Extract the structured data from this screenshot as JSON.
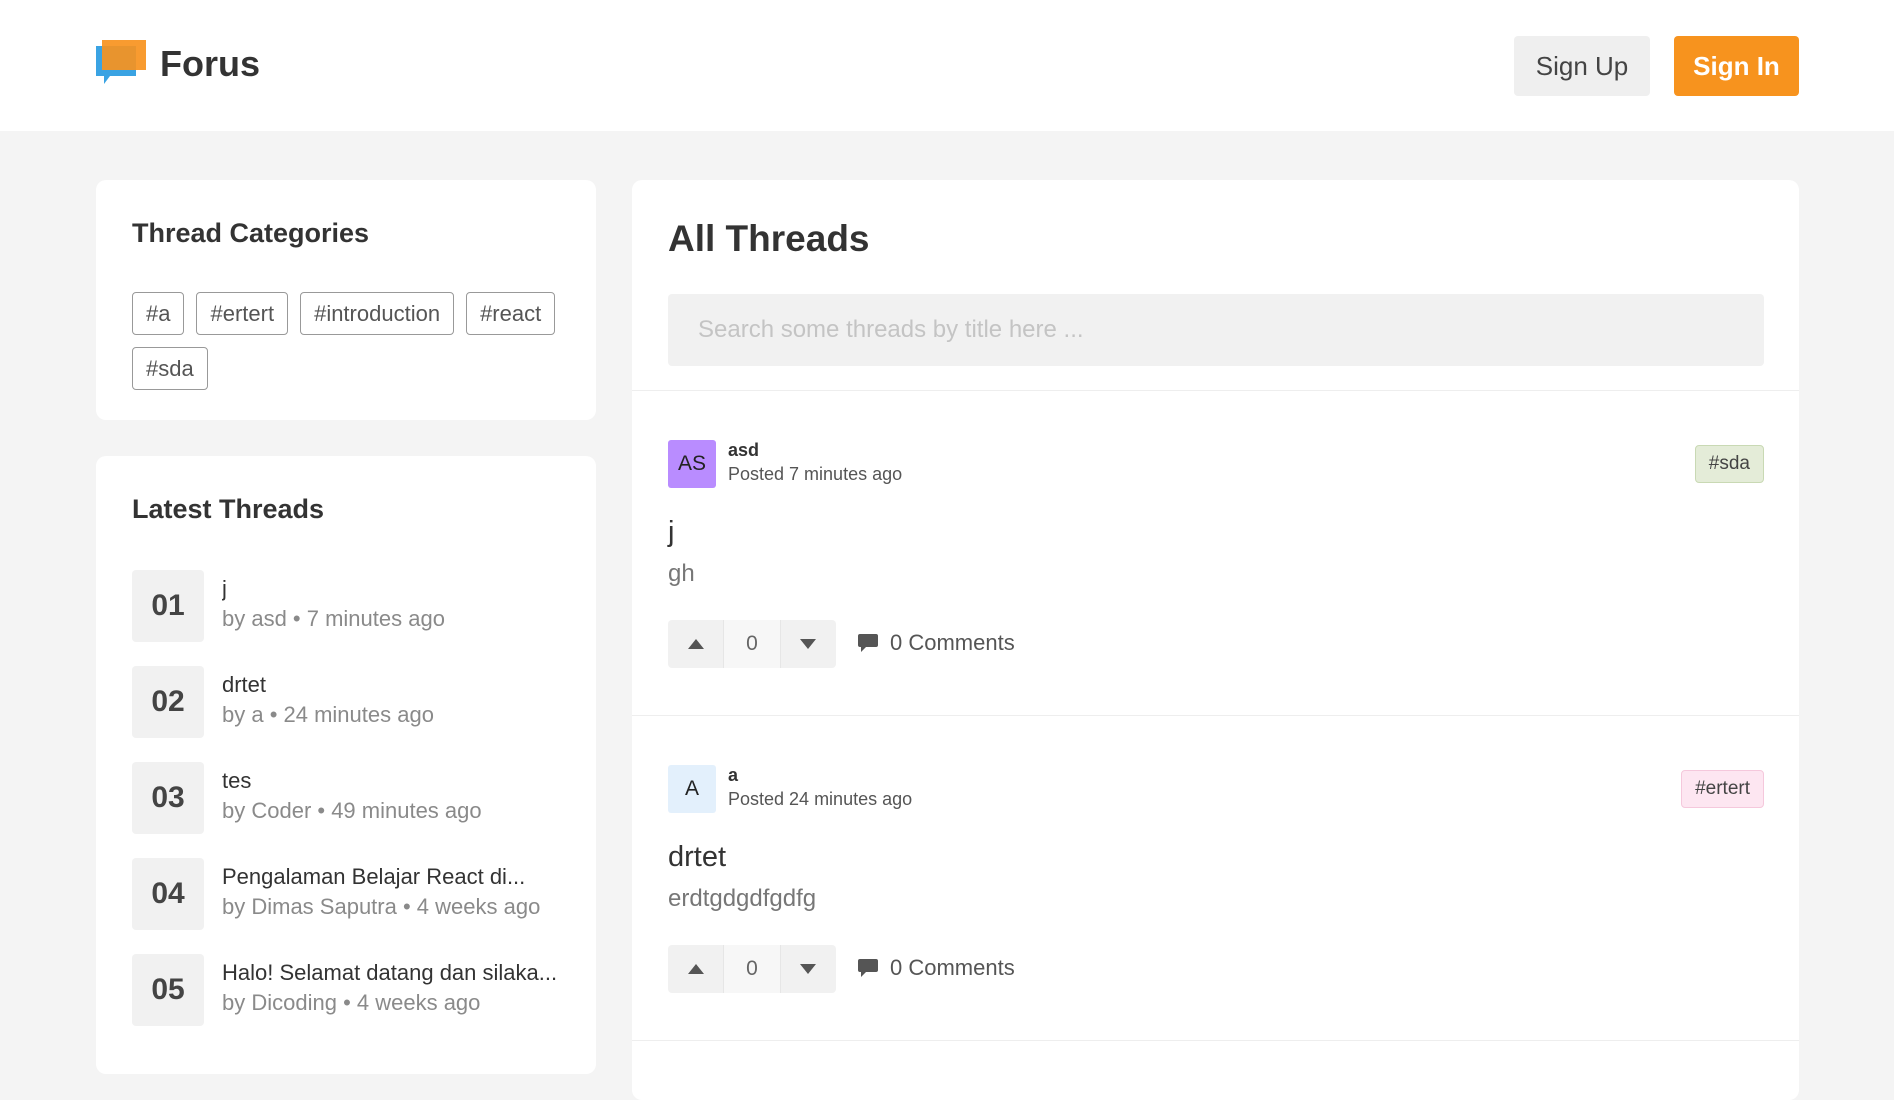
{
  "header": {
    "app_name": "Forus",
    "sign_up_label": "Sign Up",
    "sign_in_label": "Sign In",
    "accent_color": "#f7931e"
  },
  "categories": {
    "title": "Thread Categories",
    "items": [
      "#a",
      "#ertert",
      "#introduction",
      "#react",
      "#sda"
    ]
  },
  "latest": {
    "title": "Latest Threads",
    "items": [
      {
        "num": "01",
        "title": "j",
        "meta": "by asd • 7 minutes ago"
      },
      {
        "num": "02",
        "title": "drtet",
        "meta": "by a • 24 minutes ago"
      },
      {
        "num": "03",
        "title": "tes",
        "meta": "by Coder • 49 minutes ago"
      },
      {
        "num": "04",
        "title": "Pengalaman Belajar React di...",
        "meta": "by Dimas Saputra • 4 weeks ago"
      },
      {
        "num": "05",
        "title": "Halo! Selamat datang dan silaka...",
        "meta": "by Dicoding • 4 weeks ago"
      }
    ]
  },
  "main": {
    "title": "All Threads",
    "search_placeholder": "Search some threads by title here ...",
    "threads": [
      {
        "avatar_initials": "AS",
        "avatar_color": "#b98cff",
        "author": "asd",
        "posted": "Posted 7 minutes ago",
        "tag": "#sda",
        "tag_bg": "#e4ecd8",
        "tag_border": "#c9d9b4",
        "title": "j",
        "body": "gh",
        "votes": "0",
        "comments": "0 Comments"
      },
      {
        "avatar_initials": "A",
        "avatar_color": "#e3f0fc",
        "author": "a",
        "posted": "Posted 24 minutes ago",
        "tag": "#ertert",
        "tag_bg": "#fde6f1",
        "tag_border": "#f5c8dc",
        "title": "drtet",
        "body": "erdtgdgdfgdfg",
        "votes": "0",
        "comments": "0 Comments"
      }
    ]
  }
}
